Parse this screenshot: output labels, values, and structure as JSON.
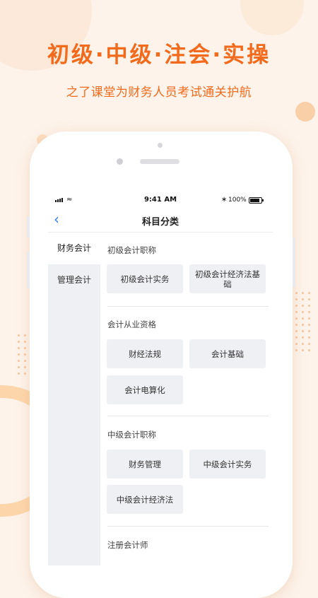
{
  "promo": {
    "headline": "初级·中级·注会·实操",
    "subline": "之了课堂为财务人员考试通关护航"
  },
  "status_bar": {
    "time": "9:41 AM",
    "battery": "100%"
  },
  "nav": {
    "back_icon": "chevron-left-icon",
    "title": "科目分类"
  },
  "sidebar": {
    "items": [
      {
        "label": "财务会计",
        "active": true
      },
      {
        "label": "管理会计",
        "active": false
      }
    ]
  },
  "sections": [
    {
      "title": "初级会计职称",
      "chips": [
        "初级会计实务",
        "初级会计经济法基础"
      ]
    },
    {
      "title": "会计从业资格",
      "chips": [
        "财经法规",
        "会计基础",
        "会计电算化"
      ]
    },
    {
      "title": "中级会计职称",
      "chips": [
        "财务管理",
        "中级会计实务",
        "中级会计经济法"
      ]
    },
    {
      "title": "注册会计师",
      "chips": []
    }
  ],
  "colors": {
    "accent": "#f26a1b",
    "link": "#2f7cf6",
    "background": "#fdf3ea",
    "chip": "#eff0f4"
  }
}
